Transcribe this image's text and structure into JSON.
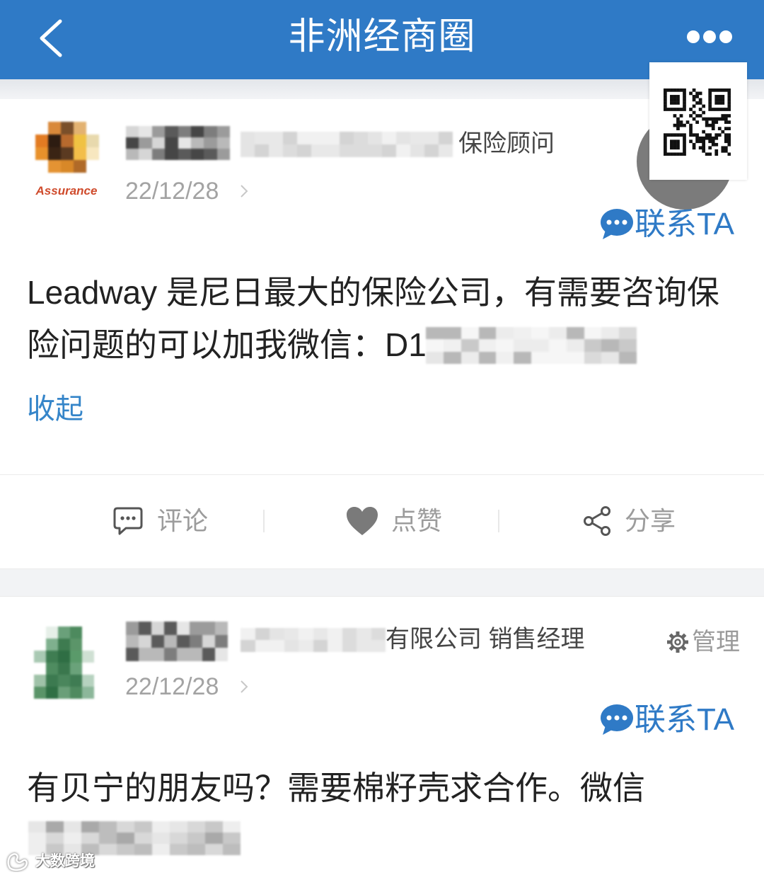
{
  "colors": {
    "accent": "#2f7ac6",
    "link": "#3585c9",
    "muted": "#a3a3a3"
  },
  "header": {
    "title": "非洲经商圈",
    "back_icon": "chevron-left-icon",
    "more_icon": "more-dots-icon"
  },
  "overlay": {
    "qr_icon": "qr-code-icon"
  },
  "posts": [
    {
      "avatar_logo_text": "Assurance",
      "author_title": "保险顾问",
      "date": "22/12/28",
      "contact_label": "联系TA",
      "contact_icon": "chat-bubble-icon",
      "body_lines": [
        "Leadway 是尼日最大的保险公司，有需要咨询保",
        "险问题的可以加我微信：D1"
      ],
      "collapse_label": "收起"
    },
    {
      "author_title": "有限公司 销售经理",
      "manage_label": "管理",
      "manage_icon": "gear-icon",
      "date": "22/12/28",
      "contact_label": "联系TA",
      "contact_icon": "chat-bubble-icon",
      "body_lines": [
        "有贝宁的朋友吗？需要棉籽壳求合作。微信"
      ]
    }
  ],
  "actions": [
    {
      "label": "评论",
      "icon": "comment-icon"
    },
    {
      "label": "点赞",
      "icon": "heart-icon"
    },
    {
      "label": "分享",
      "icon": "share-icon"
    }
  ],
  "watermark": {
    "text": "大数跨境",
    "icon": "watermark-logo-icon"
  }
}
